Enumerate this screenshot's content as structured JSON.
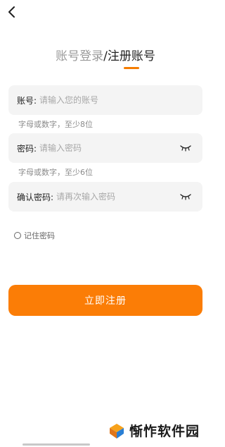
{
  "header": {
    "back_icon": "chevron-left-icon",
    "title_login": "账号登录",
    "title_separator": "/",
    "title_register": "注册账号",
    "accent_color": "#f57c00"
  },
  "form": {
    "account": {
      "label": "账号:",
      "placeholder": "请输入您的账号",
      "value": "",
      "hint": "字母或数字，至少8位"
    },
    "password": {
      "label": "密码:",
      "placeholder": "请输入密码",
      "value": "",
      "hint": "字母或数字，至少6位",
      "toggle_icon": "eye-closed-icon"
    },
    "confirm_password": {
      "label": "确认密码:",
      "placeholder": "请再次输入密码",
      "value": "",
      "toggle_icon": "eye-closed-icon"
    },
    "remember": {
      "label": "记住密码",
      "checked": false
    },
    "submit_label": "立即注册",
    "submit_color": "#fb7d06"
  },
  "watermark": {
    "text": "Ⓜ惭怍软件园"
  }
}
